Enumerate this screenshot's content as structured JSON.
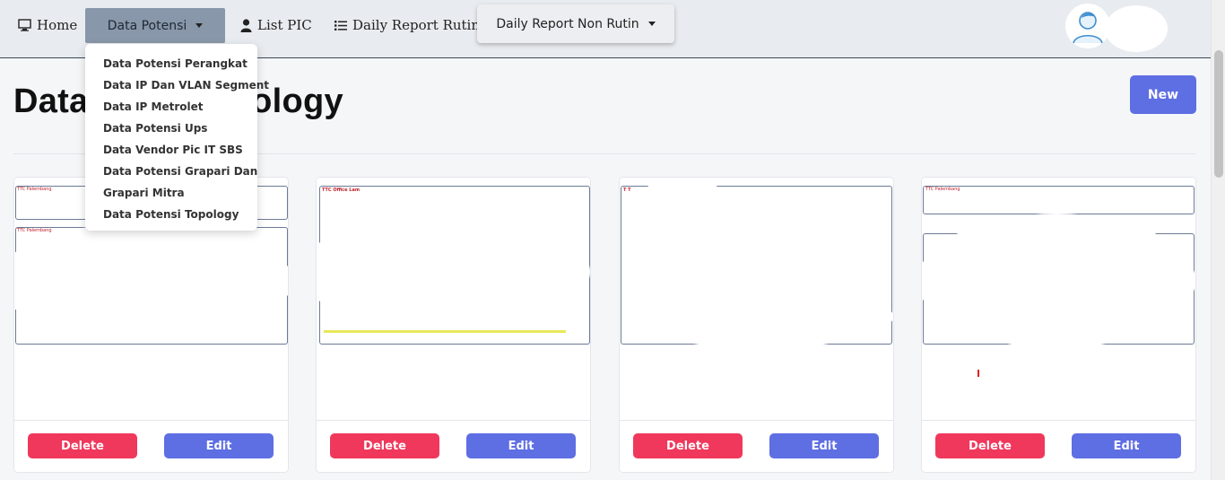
{
  "navbar": {
    "home": "Home",
    "data_potensi": "Data Potensi",
    "list_pic": "List PIC",
    "daily_rutin": "Daily Report Rutin",
    "daily_non_rutin": "Daily Report Non Rutin"
  },
  "dropdown": {
    "items": [
      "Data Potensi Perangkat",
      "Data IP Dan VLAN Segment",
      "Data IP Metrolet",
      "Data Potensi Ups",
      "Data Vendor Pic IT SBS",
      "Data Potensi Grapari Dan",
      "Grapari Mitra",
      "Data Potensi Topology"
    ]
  },
  "page": {
    "title_left": "Data",
    "title_right": "pology",
    "new_label": "New"
  },
  "cards": [
    {
      "label_top": "TTC Palembang",
      "label_bottom": "TTC Palembang",
      "delete": "Delete",
      "edit": "Edit"
    },
    {
      "label_top": "TTC Office Lam",
      "delete": "Delete",
      "edit": "Edit"
    },
    {
      "label_top": "T T",
      "delete": "Delete",
      "edit": "Edit"
    },
    {
      "label_top": "TTC Palembang",
      "delete": "Delete",
      "edit": "Edit"
    }
  ],
  "colors": {
    "primary": "#5e6ee3",
    "danger": "#f0385c",
    "nav_active": "#8897a9",
    "navbar_bg": "#e8ebef"
  }
}
